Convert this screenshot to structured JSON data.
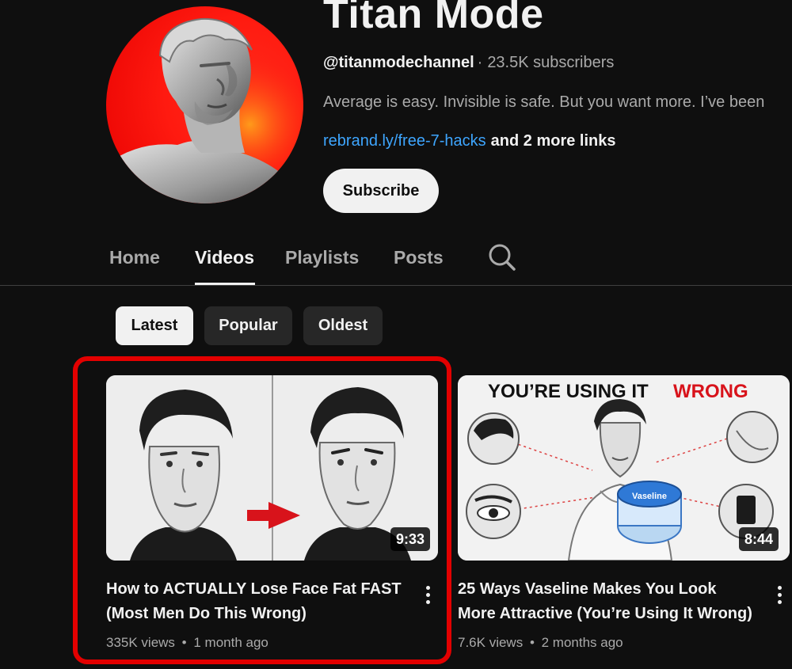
{
  "channel": {
    "title": "Titan Mode",
    "handle": "@titanmodechannel",
    "separator": "·",
    "subscribers": "23.5K subscribers",
    "description": "Average is easy. Invisible is safe. But you want more. I’ve been",
    "link_text": "rebrand.ly/free-7-hacks",
    "more_links": "and 2 more links",
    "subscribe_label": "Subscribe"
  },
  "tabs": [
    {
      "label": "Home",
      "active": false
    },
    {
      "label": "Videos",
      "active": true
    },
    {
      "label": "Playlists",
      "active": false
    },
    {
      "label": "Posts",
      "active": false
    }
  ],
  "search_icon": "search-icon",
  "filters": [
    {
      "label": "Latest",
      "selected": true
    },
    {
      "label": "Popular",
      "selected": false
    },
    {
      "label": "Oldest",
      "selected": false
    }
  ],
  "videos": [
    {
      "title_line1": "How to ACTUALLY Lose Face Fat FAST",
      "title_line2": "(Most Men Do This Wrong)",
      "duration": "9:33",
      "views": "335K views",
      "meta_sep": "•",
      "age": "1 month ago",
      "highlighted": true
    },
    {
      "title_line1": "25 Ways Vaseline Makes You Look",
      "title_line2": "More Attractive (You’re Using It Wrong)",
      "duration": "8:44",
      "views": "7.6K views",
      "meta_sep": "•",
      "age": "2 months ago",
      "thumb_text_a": "YOU’RE USING IT",
      "thumb_text_b": "WRONG",
      "jar_label": "Vaseline",
      "highlighted": false
    }
  ],
  "colors": {
    "background": "#0f0f0f",
    "link": "#3ea6ff",
    "highlight": "#e30000",
    "avatar_red": "#ff1a10"
  }
}
